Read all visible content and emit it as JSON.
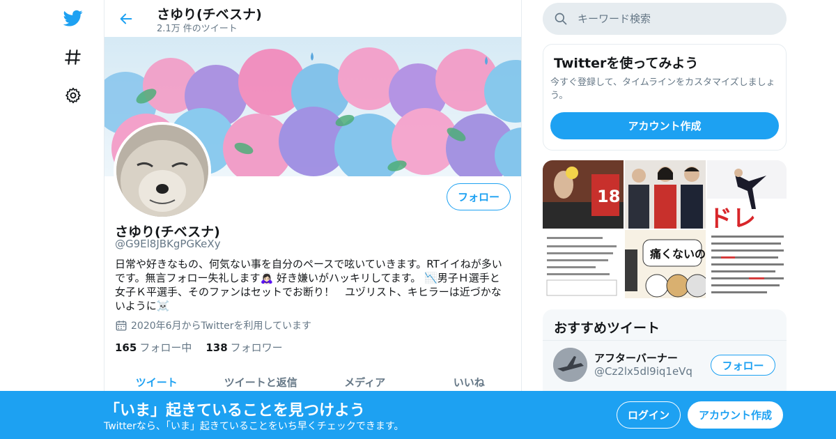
{
  "header": {
    "name": "さゆり(チベスナ)",
    "tweet_count": "2.1万 件のツイート"
  },
  "profile": {
    "name": "さゆり(チベスナ)",
    "handle": "@G9El8JBKgPGKeXy",
    "bio": "日常や好きなもの、何気ない事を自分のペースで呟いていきます。RTイイねが多いです。無言フォロー失礼します🙇🏻‍♀️ 好き嫌いがハッキリしてます。 📉男子Ｈ選手と女子Ｋ平選手、そのファンはセットでお断り！　ユヅリスト、キヒラーは近づかないように☠️",
    "joined": "2020年6月からTwitterを利用しています",
    "following_count": "165",
    "following_label": "フォロー中",
    "followers_count": "138",
    "followers_label": "フォロワー",
    "follow_button": "フォロー"
  },
  "tabs": [
    "ツイート",
    "ツイートと返信",
    "メディア",
    "いいね"
  ],
  "search": {
    "placeholder": "キーワード検索"
  },
  "signup_card": {
    "title": "Twitterを使ってみよう",
    "description": "今すぐ登録して、タイムラインをカスタマイズしましょう。",
    "button": "アカウント作成"
  },
  "media": {
    "cell5_text": "痛くないの？",
    "cell3_text": "ドレ"
  },
  "recommended": {
    "title": "おすすめツイート",
    "user_name": "アフターバーナー",
    "user_handle": "@Cz2lx5dl9iq1eVq",
    "follow_button": "フォロー"
  },
  "bottom_bar": {
    "title": "「いま」起きていることを見つけよう",
    "subtitle": "Twitterなら、「いま」起きていることをいち早くチェックできます。",
    "login": "ログイン",
    "signup": "アカウント作成"
  },
  "colors": {
    "accent": "#1da1f2",
    "secondary_text": "#657786"
  },
  "icons": [
    "twitter-bird-icon",
    "hashtag-icon",
    "gear-icon",
    "back-arrow-icon",
    "search-icon",
    "calendar-icon"
  ]
}
